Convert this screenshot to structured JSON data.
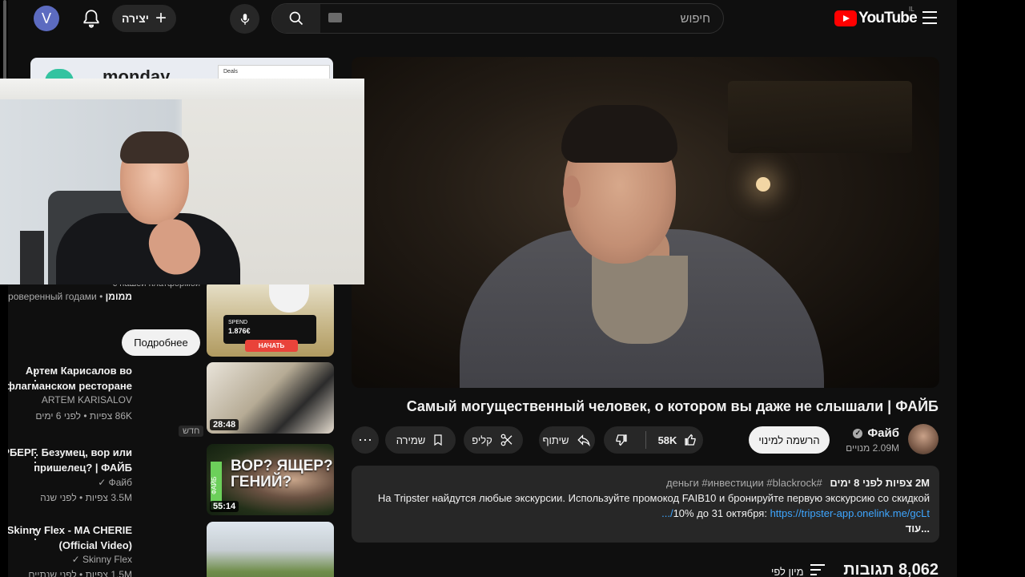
{
  "header": {
    "avatar_letter": "V",
    "create_label": "יצירה",
    "search_placeholder": "חיפוש",
    "logo_text": "YouTube",
    "region": "IL"
  },
  "video": {
    "title": "Самый могущественный человек, о котором вы даже не слышали | ФАЙБ",
    "channel_name": "Файб",
    "subscribers": "2.09M מנויים",
    "subscribe_label": "הרשמה למינוי",
    "likes": "58K",
    "share_label": "שיתוף",
    "clip_label": "קליפ",
    "save_label": "שמירה",
    "more_label": "⋯"
  },
  "description": {
    "meta": "2M צפיות  לפני 8 ימים",
    "hashtags": "#деньги #инвестиции #blackrock",
    "text": "На Tripster найдутся любые экскурсии. Используйте промокод FAIB10 и бронируйте первую экскурсию со скидкой 10% до 31 октября: ",
    "link": "https://tripster-app.onelink.me/gcLt/...",
    "more": "...עוד"
  },
  "comments": {
    "count": "8,062 תגובות",
    "sort_label": "מיון לפי"
  },
  "sidebar": {
    "ad": {
      "brand_text": "monday",
      "panel_text": "Deals",
      "line1": "с нашей платформой",
      "sponsor": "ממומן",
      "tagline": "Опыт, проверенный годами",
      "more_button": "Подробнее",
      "spend_label": "SPEND",
      "spend_value": "1.876€",
      "cta": "НАЧАТЬ"
    },
    "recs": [
      {
        "title": "Артем Карисалов во флагманском ресторане ...",
        "channel": "ARTEM KARISALOV",
        "stats": "86K צפיות • לפני 6 ימים",
        "badge": "חדש",
        "duration": "28:48"
      },
      {
        "title": "ЦУКЕРБЕРГ. Безумец, вор или пришелец? | ФАЙБ",
        "channel": "Файб",
        "stats": "3.5M צפיות • לפני שנה",
        "duration": "55:14",
        "thumb_text": "ВОР? ЯЩЕР? ГЕНИЙ?",
        "thumb_side": "ФАЙБ"
      },
      {
        "title": "Skinny Flex - MA CHERIE (Official Video)",
        "channel": "Skinny Flex",
        "stats": "1.5M צפיות • לפני שנתיים"
      }
    ]
  },
  "colors": {
    "background": "#0f0f0f",
    "surface": "#272727",
    "text": "#f1f1f1",
    "muted": "#aaaaaa",
    "link": "#3ea6ff",
    "brand_red": "#ff0000"
  }
}
